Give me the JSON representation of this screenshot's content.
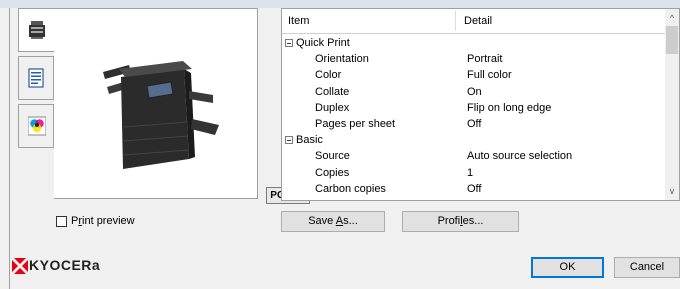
{
  "left_tabs": [
    {
      "icon": "printer-icon",
      "selected": true
    },
    {
      "icon": "document-icon",
      "selected": false
    },
    {
      "icon": "color-icon",
      "selected": false
    }
  ],
  "preview": {
    "badge": "PCL XL"
  },
  "grid": {
    "columns": [
      "Item",
      "Detail"
    ],
    "rows": [
      {
        "type": "group",
        "label": "Quick Print"
      },
      {
        "type": "item",
        "label": "Orientation",
        "value": "Portrait"
      },
      {
        "type": "item",
        "label": "Color",
        "value": "Full color"
      },
      {
        "type": "item",
        "label": "Collate",
        "value": "On"
      },
      {
        "type": "item",
        "label": "Duplex",
        "value": "Flip on long edge"
      },
      {
        "type": "item",
        "label": "Pages per sheet",
        "value": "Off"
      },
      {
        "type": "group",
        "label": "Basic"
      },
      {
        "type": "item",
        "label": "Source",
        "value": "Auto source selection"
      },
      {
        "type": "item",
        "label": "Copies",
        "value": "1"
      },
      {
        "type": "item",
        "label": "Carbon copies",
        "value": "Off"
      }
    ]
  },
  "print_preview": {
    "label_pre": "P",
    "label_u": "r",
    "label_post": "int preview",
    "checked": false
  },
  "buttons": {
    "save_as": {
      "pre": "Save ",
      "u": "A",
      "post": "s..."
    },
    "profiles": {
      "pre": "Profi",
      "u": "l",
      "post": "es..."
    },
    "ok": "OK",
    "cancel": "Cancel"
  },
  "brand": {
    "name": "KYOCERa",
    "color": "#e60012"
  }
}
